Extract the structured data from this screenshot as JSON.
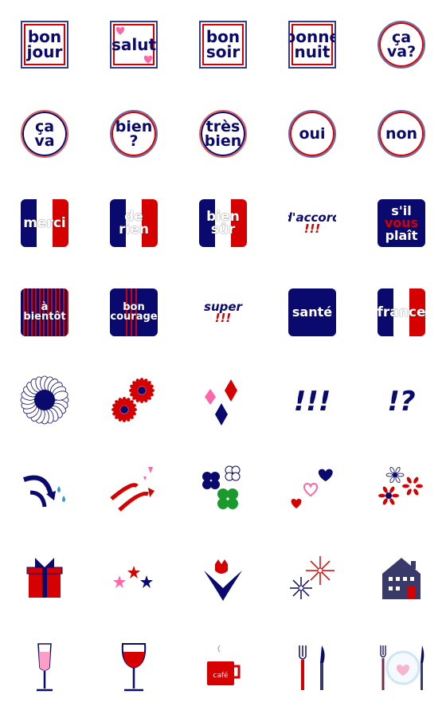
{
  "colors": {
    "navy": "#0a0a6e",
    "red": "#d60000",
    "pink": "#ff66cc",
    "green": "#1a9a2a"
  },
  "stickers": [
    {
      "type": "square-frame",
      "lines": [
        "bon",
        "jour"
      ]
    },
    {
      "type": "square-frame",
      "lines": [
        "salut"
      ],
      "decor": "pink-hearts"
    },
    {
      "type": "square-frame",
      "lines": [
        "bon",
        "soir"
      ]
    },
    {
      "type": "square-frame",
      "lines": [
        "bonne",
        "nuit"
      ]
    },
    {
      "type": "circle",
      "lines": [
        "ça",
        "va?"
      ]
    },
    {
      "type": "circle inv",
      "lines": [
        "ça",
        "va"
      ]
    },
    {
      "type": "circle",
      "lines": [
        "bien",
        "?"
      ]
    },
    {
      "type": "circle inv",
      "lines": [
        "très",
        "bien"
      ]
    },
    {
      "type": "circle",
      "lines": [
        "oui"
      ]
    },
    {
      "type": "circle",
      "lines": [
        "non"
      ]
    },
    {
      "type": "flag",
      "lines": [
        "merci"
      ]
    },
    {
      "type": "flag",
      "lines": [
        "de",
        "rien"
      ]
    },
    {
      "type": "flag",
      "lines": [
        "bien",
        "sûr"
      ]
    },
    {
      "type": "plain",
      "lines": [
        "d'accord",
        "!!!"
      ],
      "red_lines": [
        1
      ]
    },
    {
      "type": "navy",
      "lines": [
        "s'il",
        "vous",
        "plaît"
      ],
      "red_lines": [
        1
      ]
    },
    {
      "type": "striped",
      "lines": [
        "à",
        "bientôt"
      ]
    },
    {
      "type": "striped2",
      "lines": [
        "bon",
        "courage"
      ]
    },
    {
      "type": "plain",
      "lines": [
        "super",
        "!!!"
      ]
    },
    {
      "type": "navy",
      "lines": [
        "santé"
      ]
    },
    {
      "type": "flag",
      "lines": [
        "france"
      ]
    },
    {
      "type": "icon",
      "icon": "sunflower-icon"
    },
    {
      "type": "icon",
      "icon": "red-flowers-icon"
    },
    {
      "type": "icon",
      "icon": "diamonds-icon"
    },
    {
      "type": "text-icon",
      "lines": [
        "!!!"
      ]
    },
    {
      "type": "text-icon",
      "lines": [
        "!?"
      ]
    },
    {
      "type": "icon",
      "icon": "arrow-drops-icon"
    },
    {
      "type": "icon",
      "icon": "arrow-sparkles-icon"
    },
    {
      "type": "icon",
      "icon": "clovers-icon"
    },
    {
      "type": "icon",
      "icon": "hearts-icon"
    },
    {
      "type": "icon",
      "icon": "flowers-icon"
    },
    {
      "type": "icon",
      "icon": "gift-icon"
    },
    {
      "type": "icon",
      "icon": "stars-icon"
    },
    {
      "type": "icon",
      "icon": "tulip-icon"
    },
    {
      "type": "icon",
      "icon": "sparkles-icon"
    },
    {
      "type": "icon",
      "icon": "house-icon"
    },
    {
      "type": "icon",
      "icon": "champagne-glass-icon"
    },
    {
      "type": "icon",
      "icon": "wine-glass-icon"
    },
    {
      "type": "icon",
      "icon": "cafe-cup-icon",
      "label": "café"
    },
    {
      "type": "icon",
      "icon": "fork-knife-icon"
    },
    {
      "type": "icon",
      "icon": "fork-knife-heart-plate-icon"
    }
  ]
}
